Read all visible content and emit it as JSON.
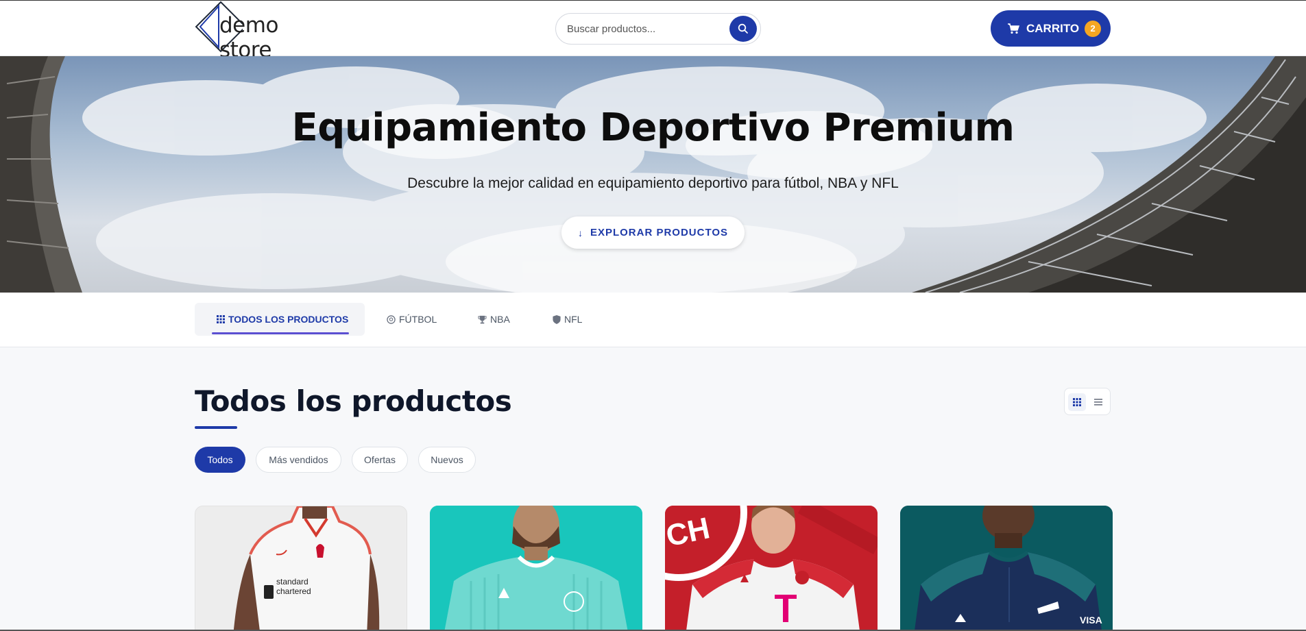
{
  "header": {
    "logo_text": "demo store",
    "search_placeholder": "Buscar productos...",
    "cart_label": "CARRITO",
    "cart_count": "2"
  },
  "hero": {
    "title": "Equipamiento Deportivo Premium",
    "subtitle": "Descubre la mejor calidad en equipamiento deportivo para fútbol, NBA y NFL",
    "cta_label": "EXPLORAR PRODUCTOS"
  },
  "categories": [
    {
      "label": "TODOS LOS PRODUCTOS",
      "icon": "grid-icon",
      "active": true
    },
    {
      "label": "FÚTBOL",
      "icon": "soccer-ball-icon",
      "active": false
    },
    {
      "label": "NBA",
      "icon": "trophy-icon",
      "active": false
    },
    {
      "label": "NFL",
      "icon": "shield-icon",
      "active": false
    }
  ],
  "main": {
    "title": "Todos los productos",
    "filters": [
      {
        "label": "Todos",
        "active": true
      },
      {
        "label": "Más vendidos",
        "active": false
      },
      {
        "label": "Ofertas",
        "active": false
      },
      {
        "label": "Nuevos",
        "active": false
      }
    ],
    "products": [
      {
        "image": "Liverpool white jersey"
      },
      {
        "image": "Inter Miami teal jersey"
      },
      {
        "image": "Bayern Munich red-white jersey"
      },
      {
        "image": "Arsenal navy-teal jersey"
      }
    ]
  },
  "colors": {
    "primary": "#1e3aa8",
    "badge": "#f5a623",
    "tab_underline": "#5b4fd1"
  }
}
